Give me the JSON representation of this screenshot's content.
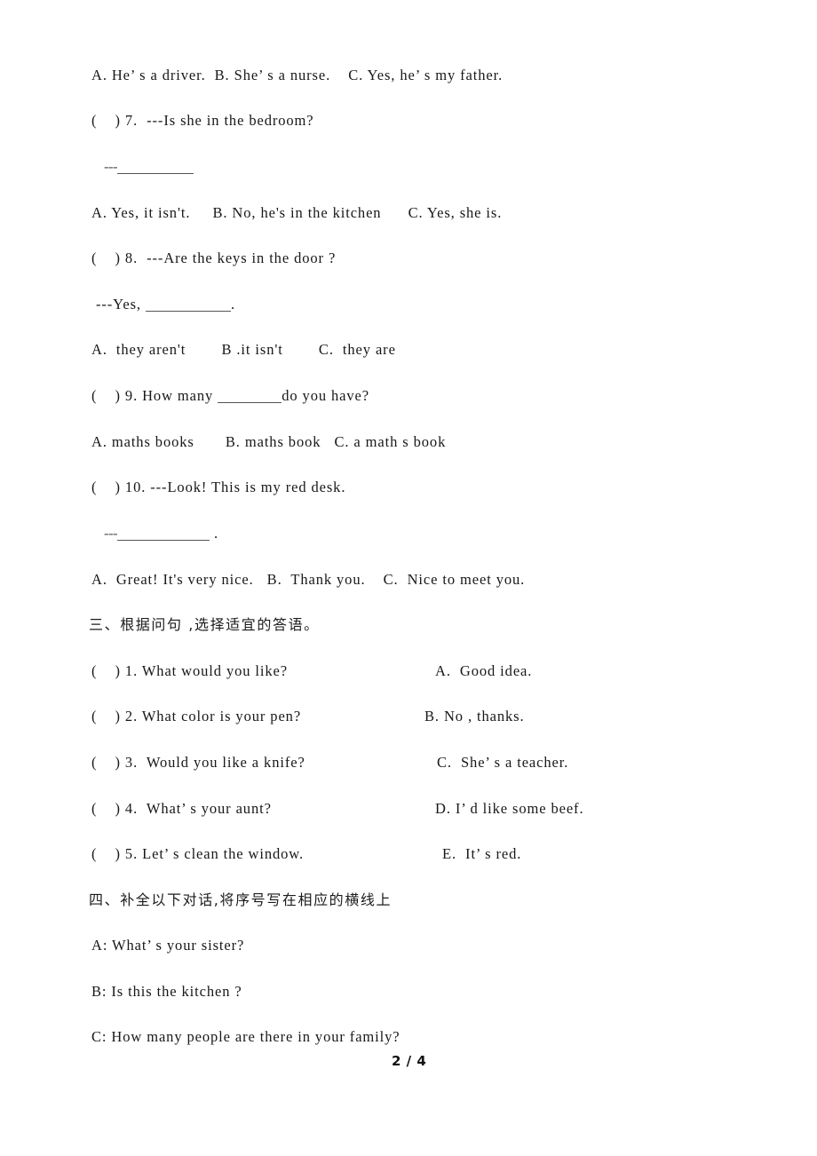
{
  "document": {
    "page_footer": "2 / 4",
    "language": "en-zh"
  },
  "section_two_continued": {
    "q6_options": "A. He’ s a driver.  B. She’ s a nurse.    C. Yes, he’ s my father.",
    "items": [
      {
        "id": "q7",
        "stem": "(    ) 7.  ---Is she in the bedroom?",
        "answer_prompt_dash": "---",
        "options": "A. Yes, it isn't.     B. No, he's in the kitchen      C. Yes, she is."
      },
      {
        "id": "q8",
        "stem": "(    ) 8.  ---Are the keys in the door ?",
        "answer_prompt_prefix": "---Yes, ",
        "answer_prompt_suffix": ".",
        "options": "A.  they aren't        B .it isn't        C.  they are"
      },
      {
        "id": "q9",
        "stem_prefix": "(    ) 9. How many ",
        "stem_suffix": "do you have?",
        "options": "A. maths books       B. maths book   C. a math s book"
      },
      {
        "id": "q10",
        "stem": "(    ) 10. ---Look! This is my red desk.",
        "answer_prompt_dash": "---",
        "answer_prompt_suffix": " .",
        "options": "A.  Great! It's very nice.   B.  Thank you.    C.  Nice to meet you."
      }
    ]
  },
  "section_three": {
    "heading": "三、根据问句 ,选择适宜的答语。",
    "left_items": [
      "(    ) 1. What would you like?",
      "(    ) 2. What color is your pen?",
      "(    ) 3.  Would you like a knife?",
      "(    ) 4.  What’ s your aunt?",
      "(    ) 5. Let’ s clean the window."
    ],
    "right_items": [
      "A.  Good idea.",
      "B. No , thanks.",
      "C.  She’ s a teacher.",
      "D. I’ d like some beef.",
      "E.  It’ s red."
    ]
  },
  "section_four": {
    "heading": "四、补全以下对话,将序号写在相应的横线上",
    "dialogue": [
      "A: What’ s your sister?",
      "B: Is this the kitchen ?",
      "C: How many people are there in your family?"
    ]
  }
}
